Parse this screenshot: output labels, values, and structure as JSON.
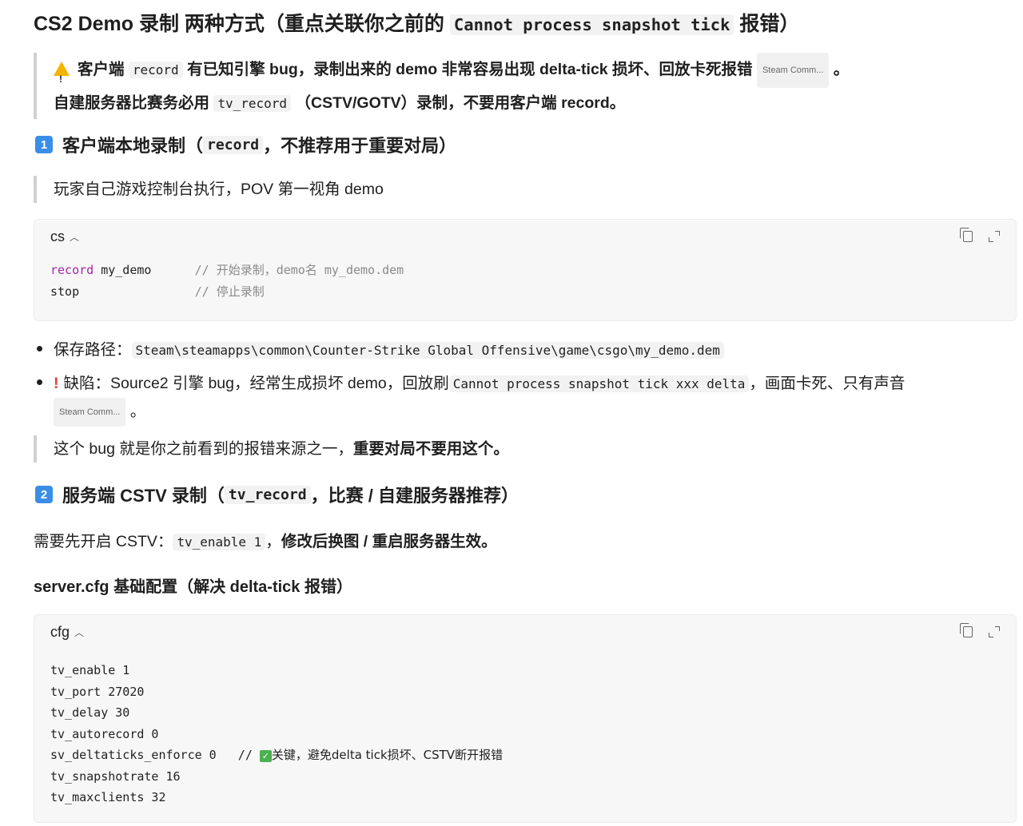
{
  "title": {
    "prefix": "CS2 Demo 录制 两种方式（重点关联你之前的",
    "code": "Cannot process snapshot tick",
    "suffix": "报错）"
  },
  "warning_quote": {
    "icon": "warning-icon",
    "l1_a": "客户端",
    "l1_code": "record",
    "l1_b": "有已知引擎 bug，录制出来的 demo 非常容易出现 delta-tick 损坏、回放卡死报错",
    "source_pill": "Steam Comm...",
    "l1_end": "。",
    "l2_a": "自建服务器比赛务必用",
    "l2_code": "tv_record",
    "l2_b": "（CSTV/GOTV）录制，不要用客户端 record。"
  },
  "section1": {
    "badge": "1",
    "a": "客户端本地录制（",
    "code": "record",
    "b": "，不推荐用于重要对局）",
    "quote": "玩家自己游戏控制台执行，POV 第一视角 demo"
  },
  "codeblock1": {
    "lang": "cs",
    "lines": [
      {
        "kw": "record",
        "text": " my_demo      ",
        "comment": "// 开始录制，demo名 my_demo.dem"
      },
      {
        "kw": "",
        "text": "stop                ",
        "comment": "// 停止录制"
      }
    ]
  },
  "bullets": {
    "b1_label": "保存路径：",
    "b1_code": "Steam\\steamapps\\common\\Counter-Strike Global Offensive\\game\\csgo\\my_demo.dem",
    "b2_mark": "!",
    "b2_a": "缺陷：Source2 引擎 bug，经常生成损坏 demo，回放刷",
    "b2_code": "Cannot process snapshot tick xxx delta",
    "b2_b": "，画面卡死、只有声音",
    "b2_pill": "Steam Comm...",
    "b2_end": "。"
  },
  "quote2": {
    "a": "这个 bug 就是你之前看到的报错来源之一，",
    "b": "重要对局不要用这个。"
  },
  "section2": {
    "badge": "2",
    "a": "服务端 CSTV 录制（",
    "code": "tv_record",
    "b": "，比赛 / 自建服务器推荐）"
  },
  "para": {
    "a": "需要先开启 CSTV：",
    "code": "tv_enable 1",
    "sep": "，",
    "b": "修改后换图 / 重启服务器生效。"
  },
  "h3": "server.cfg 基础配置（解决 delta-tick 报错）",
  "codeblock2": {
    "lang": "cfg",
    "lines": [
      {
        "text": "tv_enable 1",
        "comment": ""
      },
      {
        "text": "tv_port 27020",
        "comment": ""
      },
      {
        "text": "tv_delay 30",
        "comment": ""
      },
      {
        "text": "tv_autorecord 0",
        "comment": ""
      },
      {
        "text": "sv_deltaticks_enforce 0   // ",
        "comment": "关键，避免delta tick损坏、CSTV断开报错",
        "check": "✓"
      },
      {
        "text": "tv_snapshotrate 16",
        "comment": ""
      },
      {
        "text": "tv_maxclients 32",
        "comment": ""
      }
    ]
  }
}
